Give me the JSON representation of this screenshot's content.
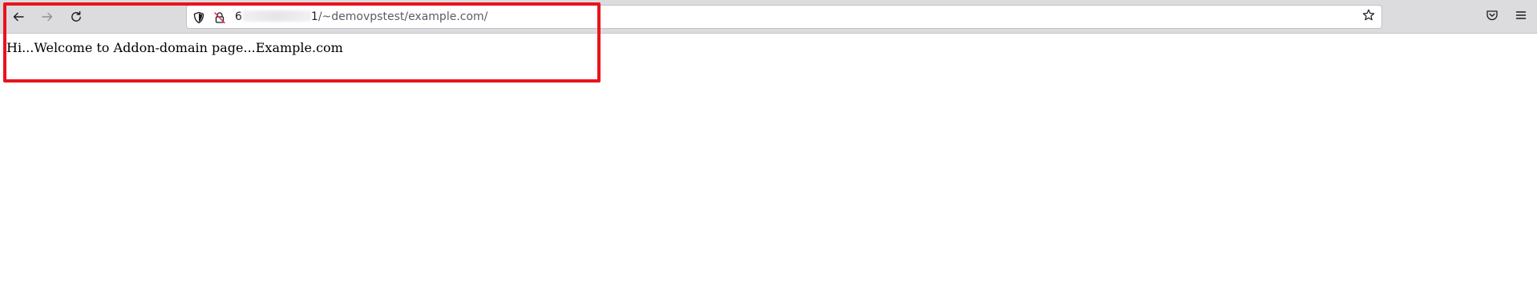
{
  "browser": {
    "back_icon": "arrow-left-icon",
    "forward_icon": "arrow-right-icon",
    "reload_icon": "reload-icon",
    "tracking_protection_icon": "shield-icon",
    "connection_icon": "insecure-lock-icon",
    "bookmark_icon": "star-icon",
    "pocket_icon": "pocket-icon",
    "menu_icon": "hamburger-menu-icon"
  },
  "urlbar": {
    "host_prefix": "6",
    "host_suffix": "1",
    "path": "/~demovpstest/example.com/"
  },
  "page": {
    "body_text": "Hi...Welcome to Addon-domain page...Example.com"
  },
  "annotation": {
    "highlight_color": "#e8141c"
  }
}
